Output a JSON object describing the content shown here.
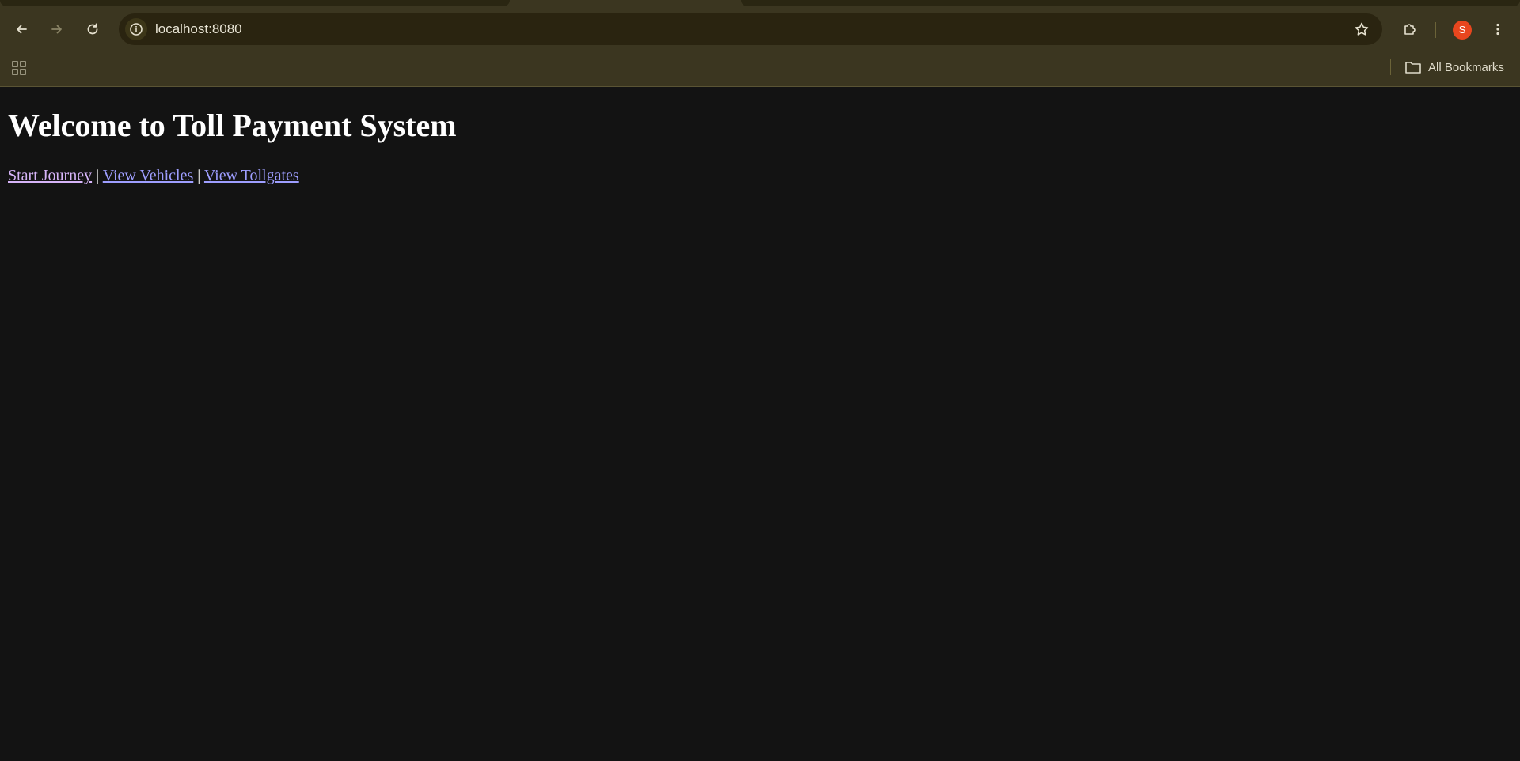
{
  "browser": {
    "url": "localhost:8080",
    "profile_initial": "S",
    "bookmarks_label": "All Bookmarks"
  },
  "page": {
    "heading": "Welcome to Toll Payment System",
    "links": [
      {
        "label": "Start Journey",
        "state": "visited"
      },
      {
        "label": "View Vehicles",
        "state": "unvisited"
      },
      {
        "label": "View Tollgates",
        "state": "unvisited"
      }
    ],
    "separator": "|"
  },
  "colors": {
    "chrome_bg": "#3b3620",
    "omnibox_bg": "#2a2410",
    "page_bg": "#131313",
    "visited_link": "#d6b4f8",
    "unvisited_link": "#9e9eff",
    "avatar": "#e8461e"
  },
  "icons": {
    "back": "back-arrow-icon",
    "forward": "forward-arrow-icon",
    "reload": "reload-icon",
    "site_info": "info-icon",
    "bookmark_star": "star-icon",
    "extensions": "puzzle-icon",
    "menu": "kebab-menu-icon",
    "apps": "apps-grid-icon",
    "bookmarks_folder": "folder-icon"
  }
}
